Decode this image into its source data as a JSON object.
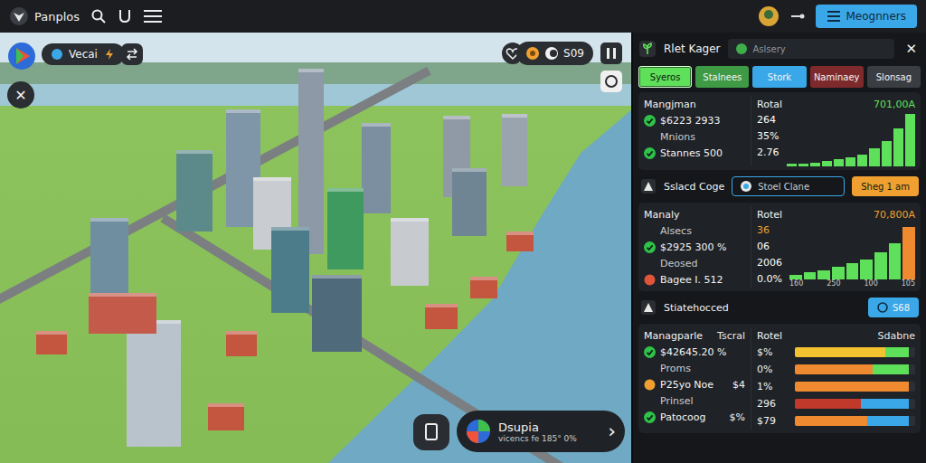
{
  "top_bar": {
    "title": "Panplos",
    "button": "Meognners"
  },
  "map": {
    "mode_pill": "Vecai",
    "close": "✕",
    "badge_value": "S09",
    "card": {
      "title": "Dsupia",
      "subtitle": "vicencs fe 185° 0%",
      "arrow": "›"
    }
  },
  "panel": {
    "title": "Rlet Kager",
    "search_placeholder": "Aslsery",
    "close": "✕"
  },
  "tabs": [
    {
      "label": "Syeros",
      "selected": true,
      "color": "#5fe05a"
    },
    {
      "label": "Stalnees",
      "selected": false,
      "color": "#3f9a45"
    },
    {
      "label": "Stork",
      "selected": false,
      "color": "#3aa8e8"
    },
    {
      "label": "Naminaey",
      "selected": false,
      "color": "#7e2a2c"
    },
    {
      "label": "Slonsag",
      "selected": false,
      "color": "#3a3d42"
    }
  ],
  "sections": [
    {
      "kind": "card",
      "title": "Mangjman",
      "caption": "",
      "items": [
        {
          "kind": "check",
          "text": "$6223 2933",
          "value": "",
          "color": "#2fc24a"
        },
        {
          "kind": "label",
          "text": "Mnions",
          "value": "",
          "color": "#2fc24a"
        },
        {
          "kind": "check",
          "text": "Stannes 500",
          "value": "",
          "color": "#2fc24a"
        }
      ],
      "right_title": "Rotal",
      "highlight": {
        "text": "701,00A",
        "color": "#5fe05a"
      },
      "right_caption": "",
      "stats": [
        {
          "text": "264",
          "color": "#ffffff"
        },
        {
          "text": "35%",
          "color": "#ffffff"
        },
        {
          "text": "2.76",
          "color": "#ffffff"
        }
      ],
      "chart": {
        "kind": "vbars",
        "values": [
          2,
          3,
          4,
          5,
          7,
          9,
          12,
          18,
          25,
          38,
          52
        ],
        "highlight_last": false,
        "ticks": []
      }
    },
    {
      "kind": "toolbar",
      "label": "Sslacd Coge",
      "field": "Stoel Clane",
      "button": "Sheg 1 am",
      "button_color": "#f0a030"
    },
    {
      "kind": "card",
      "title": "Manaly",
      "caption": "",
      "items": [
        {
          "kind": "label",
          "text": "Alsecs",
          "value": "",
          "color": "#2fc24a"
        },
        {
          "kind": "check",
          "text": "$2925 300 %",
          "value": "",
          "color": "#2fc24a"
        },
        {
          "kind": "label",
          "text": "Deosed",
          "value": "",
          "color": "#2fc24a"
        },
        {
          "kind": "dot",
          "text": "Bagee I. 512",
          "value": "",
          "color": "#e0553a"
        }
      ],
      "right_title": "Rotel",
      "highlight": {
        "text": "70,800A",
        "color": "#f0a030"
      },
      "right_caption": "",
      "stats": [
        {
          "text": "36",
          "color": "#f0a030"
        },
        {
          "text": "06",
          "color": "#ffffff"
        },
        {
          "text": "2006",
          "color": "#ffffff"
        },
        {
          "text": "0.0%",
          "color": "#ffffff"
        }
      ],
      "chart": {
        "kind": "vbars",
        "values": [
          5,
          8,
          10,
          14,
          18,
          22,
          30,
          40,
          58
        ],
        "highlight_last": true,
        "ticks": [
          "160",
          "250",
          "100",
          "105"
        ]
      }
    },
    {
      "kind": "toolbar",
      "label": "Stiatehocced",
      "field": "",
      "button": "S68",
      "button_color": "#3aa8e8"
    },
    {
      "kind": "card",
      "title": "Managparle",
      "caption": "Tscral",
      "items": [
        {
          "kind": "check",
          "text": "$42645.20 %",
          "value": "",
          "color": "#2fc24a"
        },
        {
          "kind": "label",
          "text": "Proms",
          "value": "",
          "color": "#2fc24a"
        },
        {
          "kind": "dot",
          "text": "P25yo Noe",
          "value": "$4",
          "color": "#f0a030"
        },
        {
          "kind": "label",
          "text": "Prinsel",
          "value": "",
          "color": "#2fc24a"
        },
        {
          "kind": "check",
          "text": "Patocoog",
          "value": "$%",
          "color": "#2fc24a"
        }
      ],
      "right_title": "Rotel",
      "highlight": {
        "text": "",
        "color": "#ffffff"
      },
      "right_caption": "Sdabne",
      "stats": [],
      "chart": {
        "kind": "hbars",
        "rows": [
          {
            "text": "$%",
            "segments": [
              {
                "level": 0.75,
                "color": "#f2c230"
              },
              {
                "level": 0.2,
                "color": "#5fe05a"
              }
            ]
          },
          {
            "text": "0%",
            "segments": [
              {
                "level": 0.65,
                "color": "#f08a30"
              },
              {
                "level": 0.3,
                "color": "#5fe05a"
              }
            ]
          },
          {
            "text": "1%",
            "segments": [
              {
                "level": 0.95,
                "color": "#f08a30"
              }
            ]
          },
          {
            "text": "296",
            "segments": [
              {
                "level": 0.55,
                "color": "#c0392b"
              },
              {
                "level": 0.4,
                "color": "#3aa8e8"
              }
            ]
          },
          {
            "text": "$79",
            "segments": [
              {
                "level": 0.6,
                "color": "#f08a30"
              },
              {
                "level": 0.35,
                "color": "#3aa8e8"
              }
            ]
          }
        ]
      }
    }
  ]
}
